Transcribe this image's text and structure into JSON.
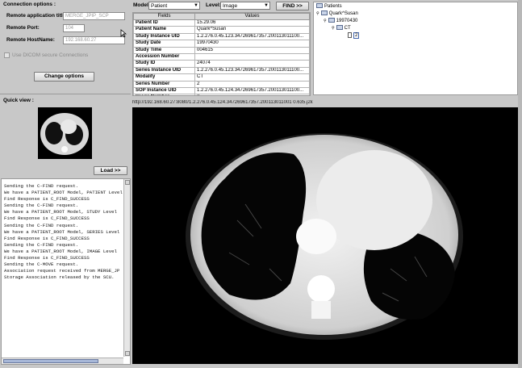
{
  "connection": {
    "section_title": "Connection options :",
    "ae_title_label": "Remote application title:",
    "ae_title_value": "MERGE_JPIP_SCP",
    "port_label": "Remote Port:",
    "port_value": "104",
    "host_label": "Remote HostName:",
    "host_value": "192.168.60.27",
    "secure_label": "Use DICOM secure Connections",
    "change_button": "Change options"
  },
  "query": {
    "model_label": "Model:",
    "model_value": "Patient",
    "level_label": "Level:",
    "level_value": "Image",
    "find_button": "FIND >>"
  },
  "tag_table": {
    "columns": [
      "Fields",
      "Values"
    ],
    "rows": [
      {
        "field": "Patient ID",
        "value": "15.29.06"
      },
      {
        "field": "Patient Name",
        "value": "Quark^Susan"
      },
      {
        "field": "Study Instance UID",
        "value": "1.2.276.0.45.123.347269617357.200113011100..."
      },
      {
        "field": "Study Date",
        "value": "19970430"
      },
      {
        "field": "Study Time",
        "value": "004615"
      },
      {
        "field": "Accession Number",
        "value": ""
      },
      {
        "field": "Study ID",
        "value": "24074"
      },
      {
        "field": "Series Instance UID",
        "value": "1.2.276.0.45.123.347269617357.200113011100..."
      },
      {
        "field": "Modality",
        "value": "CT"
      },
      {
        "field": "Series Number",
        "value": "2"
      },
      {
        "field": "SOP Instance UID",
        "value": "1.2.276.0.45.124.347269617357.200113011100..."
      },
      {
        "field": "Image Number",
        "value": "2"
      }
    ]
  },
  "tree": {
    "root": "Patients",
    "patient": "Quark^Susan",
    "study": "19970430",
    "series": "CT",
    "image": "2"
  },
  "quick_view": {
    "title": "Quick view :",
    "load_button": "Load >>"
  },
  "viewer": {
    "url": "http://192.168.60.27:8080/1.2.276.0.45.124.347269617357.200113011001 0.635.j2k"
  },
  "log_lines": [
    "Sending the C-FIND request.",
    "We have a PATIENT_ROOT Model, PATIENT Level",
    "Find Response is C_FIND_SUCCESS",
    "Sending the C-FIND request.",
    "We have a PATIENT_ROOT Model, STUDY Level",
    "Find Response is C_FIND_SUCCESS",
    "Sending the C-FIND request.",
    "We have a PATIENT_ROOT Model, SERIES Level",
    "Find Response is C_FIND_SUCCESS",
    "Sending the C-FIND request.",
    "We have a PATIENT_ROOT Model, IMAGE Level",
    "Find Response is C_FIND_SUCCESS",
    "Sending the C-MOVE request.",
    "Association request received from MERGE_JP",
    "Storage Association released by the SCU."
  ]
}
